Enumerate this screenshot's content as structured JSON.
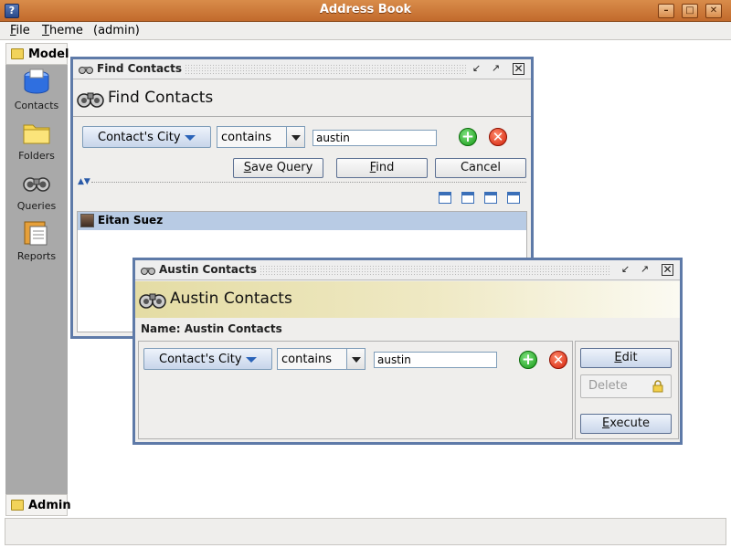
{
  "window": {
    "title": "Address Book",
    "controls": {
      "minimize": "–",
      "maximize": "□",
      "close": "✕"
    }
  },
  "menubar": {
    "file": {
      "mnemonic": "F",
      "rest": "ile"
    },
    "theme": {
      "mnemonic": "T",
      "rest": "heme"
    },
    "user": "(admin)"
  },
  "sidebar": {
    "header": "Model",
    "items": [
      {
        "label": "Contacts",
        "icon": "contacts-icon"
      },
      {
        "label": "Folders",
        "icon": "folder-icon"
      },
      {
        "label": "Queries",
        "icon": "binoculars-icon"
      },
      {
        "label": "Reports",
        "icon": "report-icon"
      }
    ],
    "footer": "Admin"
  },
  "find_contacts": {
    "title": "Find Contacts",
    "banner": "Find Contacts",
    "field": "Contact's City",
    "operator": "contains",
    "value": "austin",
    "buttons": {
      "save_query": {
        "mnemonic": "S",
        "rest": "ave Query"
      },
      "find": {
        "mnemonic": "F",
        "rest": "ind"
      },
      "cancel": "Cancel"
    },
    "results": [
      {
        "name": "Eitan Suez"
      }
    ]
  },
  "austin_contacts": {
    "title": "Austin Contacts",
    "banner": "Austin Contacts",
    "name_label": "Name: Austin Contacts",
    "field": "Contact's City",
    "operator": "contains",
    "value": "austin",
    "buttons": {
      "edit": {
        "mnemonic": "E",
        "rest": "dit"
      },
      "delete": "Delete",
      "execute": {
        "mnemonic": "E",
        "rest": "xecute"
      }
    }
  },
  "colors": {
    "titlebar": "#c8743a",
    "frame_border": "#5e7aa8",
    "selection": "#b8cbe4",
    "sidebar": "#a9a9a9",
    "banner_gold": "#e4dca4"
  }
}
